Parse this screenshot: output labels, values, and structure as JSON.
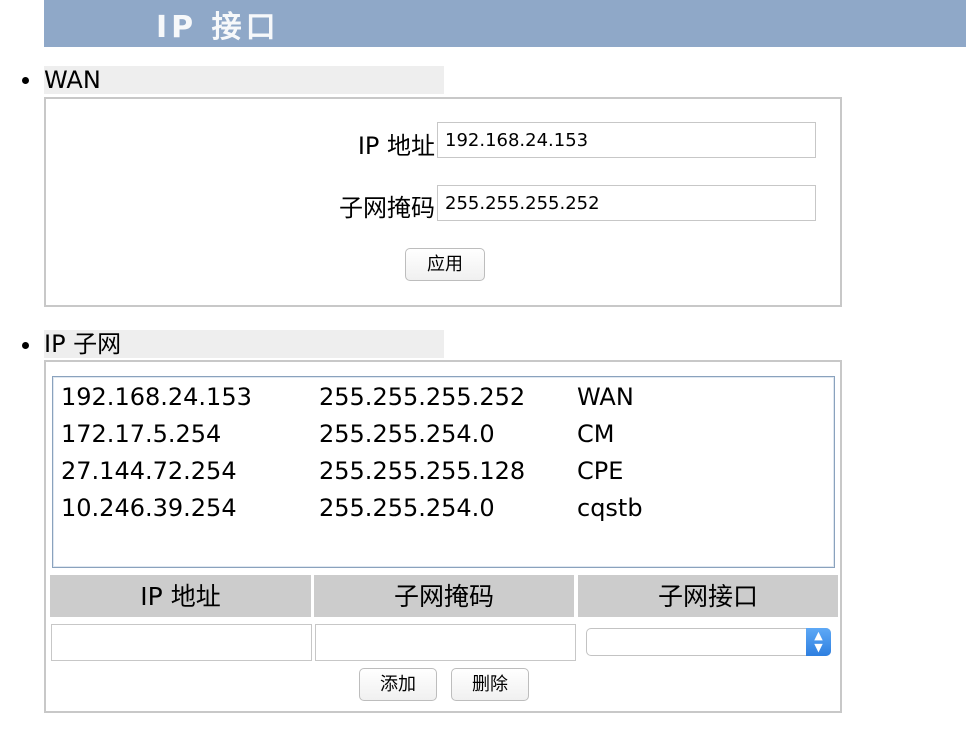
{
  "banner": {
    "title": "IP 接口"
  },
  "wan": {
    "heading": "WAN",
    "ip_label": "IP 地址",
    "ip_value": "192.168.24.153",
    "mask_label": "子网掩码",
    "mask_value": "255.255.255.252",
    "apply_label": "应用"
  },
  "subnet": {
    "heading": "IP 子网",
    "rows": [
      {
        "ip": "192.168.24.153",
        "mask": "255.255.255.252",
        "iface": "WAN"
      },
      {
        "ip": "172.17.5.254",
        "mask": "255.255.254.0",
        "iface": "CM"
      },
      {
        "ip": "27.144.72.254",
        "mask": "255.255.255.128",
        "iface": "CPE"
      },
      {
        "ip": "10.246.39.254",
        "mask": "255.255.254.0",
        "iface": "cqstb"
      }
    ],
    "columns": [
      "IP 地址",
      "子网掩码",
      "子网接口"
    ],
    "new_ip": "",
    "new_mask": "",
    "new_iface": "",
    "add_label": "添加",
    "delete_label": "删除"
  },
  "colors": {
    "banner": "#8fa8c8",
    "header_cell": "#cccccc",
    "select_accent": "#3d8ef0"
  },
  "icons": {
    "select": "updown-chevron-icon",
    "bullet": "bullet-dot-icon"
  }
}
